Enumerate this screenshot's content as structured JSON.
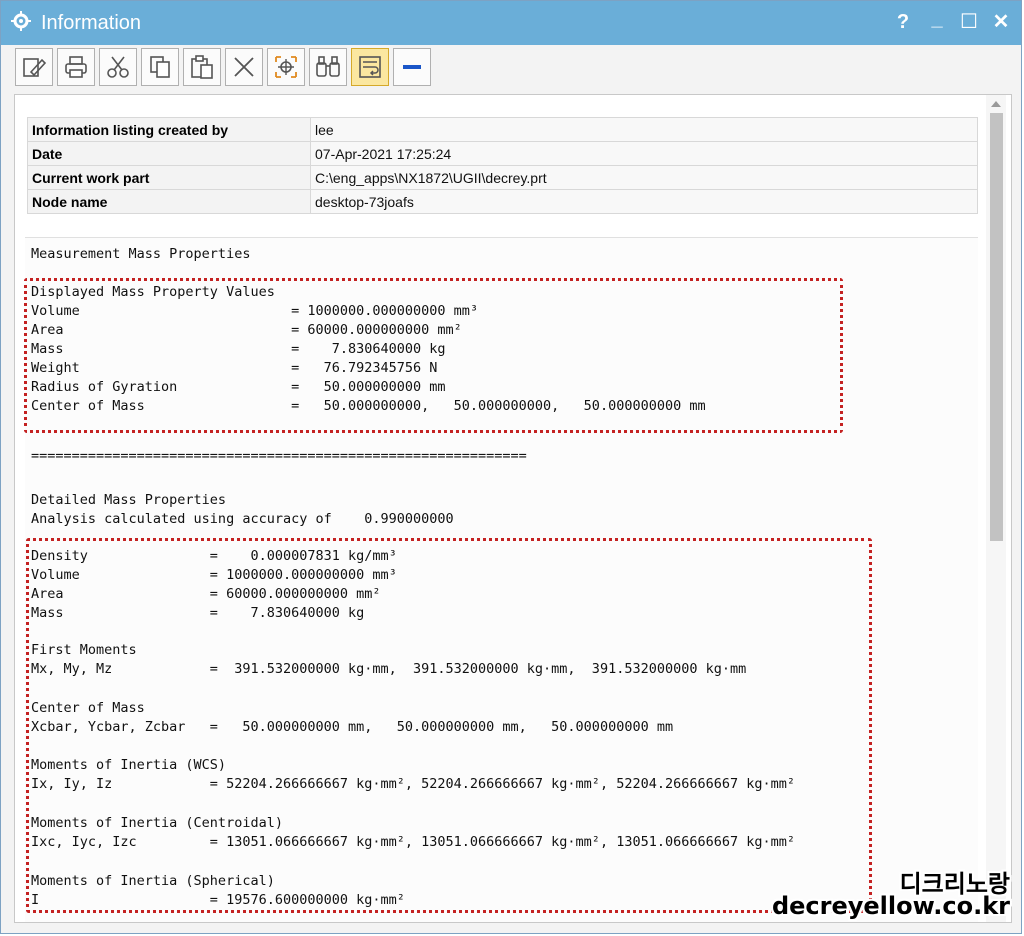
{
  "window": {
    "title": "Information"
  },
  "titlebar": {
    "help": "?",
    "minimize": "_",
    "maximize": "☐",
    "close": "✕"
  },
  "toolbar": {
    "buttons": [
      "edit",
      "print",
      "cut",
      "copy",
      "paste",
      "delete",
      "find-center",
      "binoculars",
      "wrap",
      "collapse"
    ]
  },
  "header_table": [
    {
      "label": "Information listing created by",
      "value": "lee"
    },
    {
      "label": "Date",
      "value": "07-Apr-2021 17:25:24"
    },
    {
      "label": "Current work part",
      "value": "C:\\eng_apps\\NX1872\\UGII\\decrey.prt"
    },
    {
      "label": "Node name",
      "value": "desktop-73joafs"
    }
  ],
  "listing": [
    "Measurement Mass Properties",
    "",
    "Displayed Mass Property Values",
    "Volume                          = 1000000.000000000 mm³",
    "Area                            = 60000.000000000 mm²",
    "Mass                            =    7.830640000 kg",
    "Weight                          =   76.792345756 N",
    "Radius of Gyration              =   50.000000000 mm",
    "Center of Mass                  =   50.000000000,   50.000000000,   50.000000000 mm",
    "",
    "=============================================================",
    "",
    "Detailed Mass Properties",
    "Analysis calculated using accuracy of    0.990000000",
    "",
    "Density               =    0.000007831 kg/mm³",
    "Volume                = 1000000.000000000 mm³",
    "Area                  = 60000.000000000 mm²",
    "Mass                  =    7.830640000 kg",
    "",
    "First Moments",
    "Mx, My, Mz            =  391.532000000 kg·mm,  391.532000000 kg·mm,  391.532000000 kg·mm",
    "",
    "Center of Mass",
    "Xcbar, Ycbar, Zcbar   =   50.000000000 mm,   50.000000000 mm,   50.000000000 mm",
    "",
    "Moments of Inertia (WCS)",
    "Ix, Iy, Iz            = 52204.266666667 kg·mm², 52204.266666667 kg·mm², 52204.266666667 kg·mm²",
    "",
    "Moments of Inertia (Centroidal)",
    "Ixc, Iyc, Izc         = 13051.066666667 kg·mm², 13051.066666667 kg·mm², 13051.066666667 kg·mm²",
    "",
    "Moments of Inertia (Spherical)",
    "I                     = 19576.600000000 kg·mm²"
  ],
  "watermark": {
    "korean": "디크리노랑",
    "site": "decreyellow.co.kr"
  },
  "colors": {
    "titlebar": "#6aaed8",
    "highlight": "#c42222"
  }
}
